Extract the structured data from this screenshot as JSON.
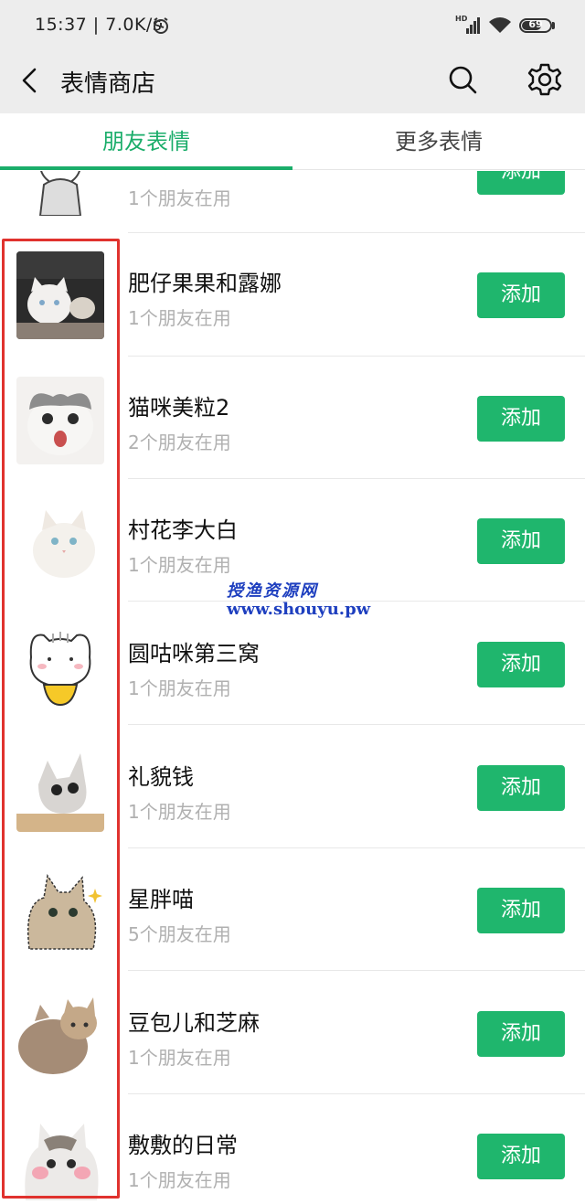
{
  "status_bar": {
    "time": "15:37 | 7.0K/s",
    "battery": "69",
    "battery_level": 0.69,
    "icons": [
      "alarm-icon",
      "hd-signal-icon",
      "wifi-icon",
      "battery-icon"
    ]
  },
  "nav": {
    "title": "表情商店",
    "icons": [
      "back-icon",
      "search-icon",
      "settings-icon"
    ]
  },
  "tabs": {
    "friends": "朋友表情",
    "more": "更多表情",
    "active": "friends"
  },
  "accent_color": "#1aad6a",
  "highlight_color": "#e0322e",
  "items": [
    {
      "name": "",
      "users": "1个朋友在用",
      "button": "添加"
    },
    {
      "name": "肥仔果果和露娜",
      "users": "1个朋友在用",
      "button": "添加"
    },
    {
      "name": "猫咪美粒2",
      "users": "2个朋友在用",
      "button": "添加"
    },
    {
      "name": "村花李大白",
      "users": "1个朋友在用",
      "button": "添加"
    },
    {
      "name": "圆咕咪第三窝",
      "users": "1个朋友在用",
      "button": "添加"
    },
    {
      "name": "礼貌钱",
      "users": "1个朋友在用",
      "button": "添加"
    },
    {
      "name": "星胖喵",
      "users": "5个朋友在用",
      "button": "添加"
    },
    {
      "name": "豆包儿和芝麻",
      "users": "1个朋友在用",
      "button": "添加"
    },
    {
      "name": "敷敷的日常",
      "users": "1个朋友在用",
      "button": "添加"
    }
  ],
  "watermark": {
    "line1": "授渔资源网",
    "line2": "www.shouyu.pw"
  }
}
